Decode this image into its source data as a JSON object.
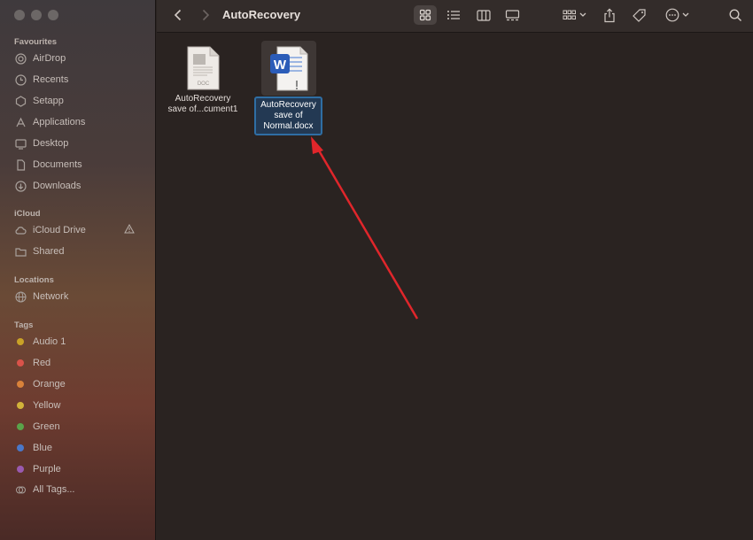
{
  "window": {
    "title": "AutoRecovery"
  },
  "sidebar": {
    "sections": {
      "favourites": "Favourites",
      "icloud": "iCloud",
      "locations": "Locations",
      "tags": "Tags"
    },
    "favourites": [
      {
        "label": "AirDrop",
        "icon": "airdrop-icon"
      },
      {
        "label": "Recents",
        "icon": "clock-icon"
      },
      {
        "label": "Setapp",
        "icon": "setapp-icon"
      },
      {
        "label": "Applications",
        "icon": "applications-icon"
      },
      {
        "label": "Desktop",
        "icon": "desktop-icon"
      },
      {
        "label": "Documents",
        "icon": "document-icon"
      },
      {
        "label": "Downloads",
        "icon": "download-icon"
      }
    ],
    "icloud": [
      {
        "label": "iCloud Drive",
        "icon": "cloud-icon"
      },
      {
        "label": "Shared",
        "icon": "shared-folder-icon"
      }
    ],
    "locations": [
      {
        "label": "Network",
        "icon": "globe-icon"
      }
    ],
    "tags": [
      {
        "label": "Audio 1",
        "color": "#c9a227"
      },
      {
        "label": "Red",
        "color": "#d9534a"
      },
      {
        "label": "Orange",
        "color": "#d9823a"
      },
      {
        "label": "Yellow",
        "color": "#d2b33a"
      },
      {
        "label": "Green",
        "color": "#5aa34a"
      },
      {
        "label": "Blue",
        "color": "#4a78c9"
      },
      {
        "label": "Purple",
        "color": "#9a5ab0"
      },
      {
        "label": "All Tags...",
        "color": ""
      }
    ]
  },
  "files": [
    {
      "line1": "AutoRecovery",
      "line2": "save of...cument1",
      "type_badge": "DOC"
    },
    {
      "line1": "AutoRecovery",
      "line2": "save of",
      "line3": "Normal.docx",
      "app_letter": "W"
    }
  ],
  "colors": {
    "selection_border": "#2f6ea4",
    "annotation_arrow": "#e0262b",
    "word_blue": "#2b5cb8"
  }
}
